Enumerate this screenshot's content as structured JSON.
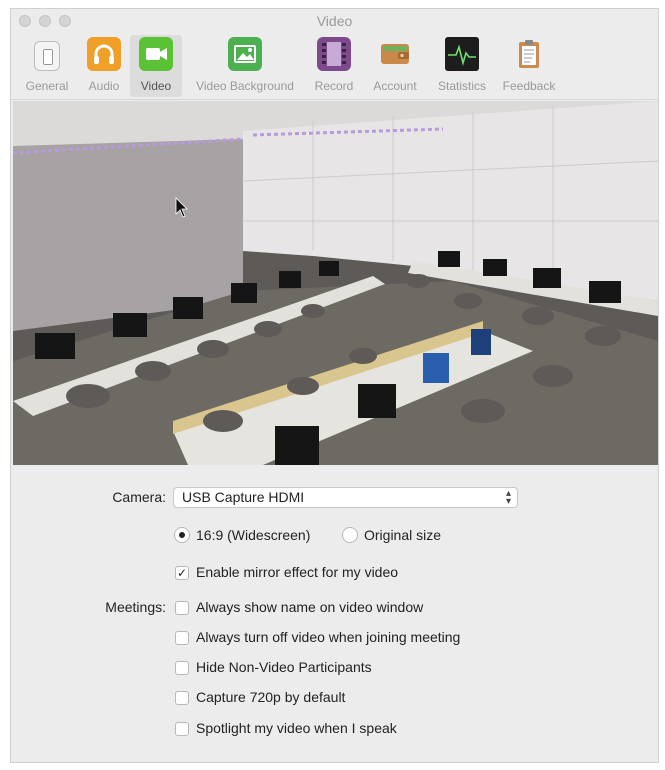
{
  "window": {
    "title": "Video"
  },
  "toolbar": {
    "items": [
      {
        "label": "General",
        "icon": "switch-icon"
      },
      {
        "label": "Audio",
        "icon": "headphones-icon"
      },
      {
        "label": "Video",
        "icon": "video-camera-icon"
      },
      {
        "label": "Video Background",
        "icon": "image-icon"
      },
      {
        "label": "Record",
        "icon": "film-strip-icon"
      },
      {
        "label": "Account",
        "icon": "wallet-icon"
      },
      {
        "label": "Statistics",
        "icon": "activity-monitor-icon"
      },
      {
        "label": "Feedback",
        "icon": "clipboard-icon"
      }
    ],
    "selected": "Video"
  },
  "settings": {
    "camera_label": "Camera:",
    "camera_value": "USB Capture HDMI",
    "aspect_options": [
      "16:9 (Widescreen)",
      "Original size"
    ],
    "aspect_selected": "16:9 (Widescreen)",
    "mirror_label": "Enable mirror effect for my video",
    "mirror_checked": true,
    "meetings_label": "Meetings:",
    "meeting_options": [
      {
        "label": "Always show name on video window",
        "checked": false
      },
      {
        "label": "Always turn off video when joining meeting",
        "checked": false
      },
      {
        "label": "Hide Non-Video Participants",
        "checked": false
      },
      {
        "label": "Capture 720p by default",
        "checked": false
      },
      {
        "label": "Spotlight my video when I speak",
        "checked": false
      }
    ]
  },
  "colors": {
    "audio_icon": "#f0a028",
    "video_icon": "#5bc236",
    "background_icon": "#4caf50",
    "window_bg": "#ececec"
  }
}
